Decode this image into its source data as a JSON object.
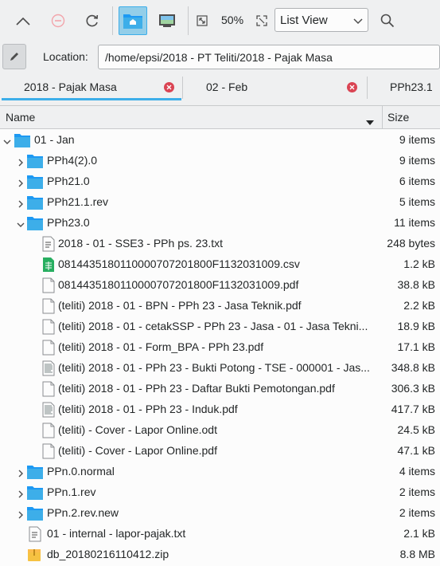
{
  "toolbar": {
    "zoom": "50%",
    "view_mode": "List View",
    "icons": [
      "navigate-up-icon",
      "stop-icon",
      "reload-icon",
      "home-folder-icon",
      "preview-icon",
      "zoom-fit-icon",
      "expand-icon",
      "search-icon"
    ]
  },
  "location": {
    "label": "Location:",
    "path": "/home/epsi/2018 - PT Teliti/2018 - Pajak Masa"
  },
  "tabs": [
    {
      "label": "2018 - Pajak Masa",
      "active": true
    },
    {
      "label": "02 - Feb",
      "active": false
    },
    {
      "label": "PPh23.1",
      "active": false
    }
  ],
  "columns": {
    "name": "Name",
    "size": "Size"
  },
  "rows": [
    {
      "name": "01 - Jan",
      "size": "9 items",
      "type": "folder",
      "level": 0,
      "expand": "open"
    },
    {
      "name": "PPh4(2).0",
      "size": "9 items",
      "type": "folder",
      "level": 1,
      "expand": "closed"
    },
    {
      "name": "PPh21.0",
      "size": "6 items",
      "type": "folder",
      "level": 1,
      "expand": "closed"
    },
    {
      "name": "PPh21.1.rev",
      "size": "5 items",
      "type": "folder",
      "level": 1,
      "expand": "closed"
    },
    {
      "name": "PPh23.0",
      "size": "11 items",
      "type": "folder",
      "level": 1,
      "expand": "open"
    },
    {
      "name": "2018 - 01 - SSE3 - PPh ps. 23.txt",
      "size": "248 bytes",
      "type": "txt",
      "level": 2,
      "expand": "none"
    },
    {
      "name": "0814435180110000707201800F1132031009.csv",
      "size": "1.2 kB",
      "type": "csv",
      "level": 2,
      "expand": "none"
    },
    {
      "name": "0814435180110000707201800F1132031009.pdf",
      "size": "38.8 kB",
      "type": "pdf",
      "level": 2,
      "expand": "none"
    },
    {
      "name": "(teliti) 2018 - 01 - BPN - PPh 23 - Jasa Teknik.pdf",
      "size": "2.2 kB",
      "type": "pdf",
      "level": 2,
      "expand": "none"
    },
    {
      "name": "(teliti) 2018 - 01 - cetakSSP - PPh 23 - Jasa - 01 - Jasa Tekni...",
      "size": "18.9 kB",
      "type": "pdf",
      "level": 2,
      "expand": "none"
    },
    {
      "name": "(teliti) 2018 - 01 - Form_BPA - PPh 23.pdf",
      "size": "17.1 kB",
      "type": "pdf",
      "level": 2,
      "expand": "none"
    },
    {
      "name": "(teliti) 2018 - 01 - PPh 23 - Bukti Potong - TSE - 000001 - Jas...",
      "size": "348.8 kB",
      "type": "pdfthumb",
      "level": 2,
      "expand": "none"
    },
    {
      "name": "(teliti) 2018 - 01 - PPh 23 - Daftar Bukti Pemotongan.pdf",
      "size": "306.3 kB",
      "type": "pdf",
      "level": 2,
      "expand": "none"
    },
    {
      "name": "(teliti) 2018 - 01 - PPh 23 - Induk.pdf",
      "size": "417.7 kB",
      "type": "pdfthumb",
      "level": 2,
      "expand": "none"
    },
    {
      "name": "(teliti) - Cover - Lapor Online.odt",
      "size": "24.5 kB",
      "type": "pdf",
      "level": 2,
      "expand": "none"
    },
    {
      "name": "(teliti) - Cover - Lapor Online.pdf",
      "size": "47.1 kB",
      "type": "pdf",
      "level": 2,
      "expand": "none"
    },
    {
      "name": "PPn.0.normal",
      "size": "4 items",
      "type": "folder",
      "level": 1,
      "expand": "closed"
    },
    {
      "name": "PPn.1.rev",
      "size": "2 items",
      "type": "folder",
      "level": 1,
      "expand": "closed"
    },
    {
      "name": "PPn.2.rev.new",
      "size": "2 items",
      "type": "folder",
      "level": 1,
      "expand": "closed"
    },
    {
      "name": "01 - internal - lapor-pajak.txt",
      "size": "2.1 kB",
      "type": "txt",
      "level": 1,
      "expand": "none"
    },
    {
      "name": "db_20180216110412.zip",
      "size": "8.8 MB",
      "type": "zip",
      "level": 1,
      "expand": "none"
    }
  ]
}
